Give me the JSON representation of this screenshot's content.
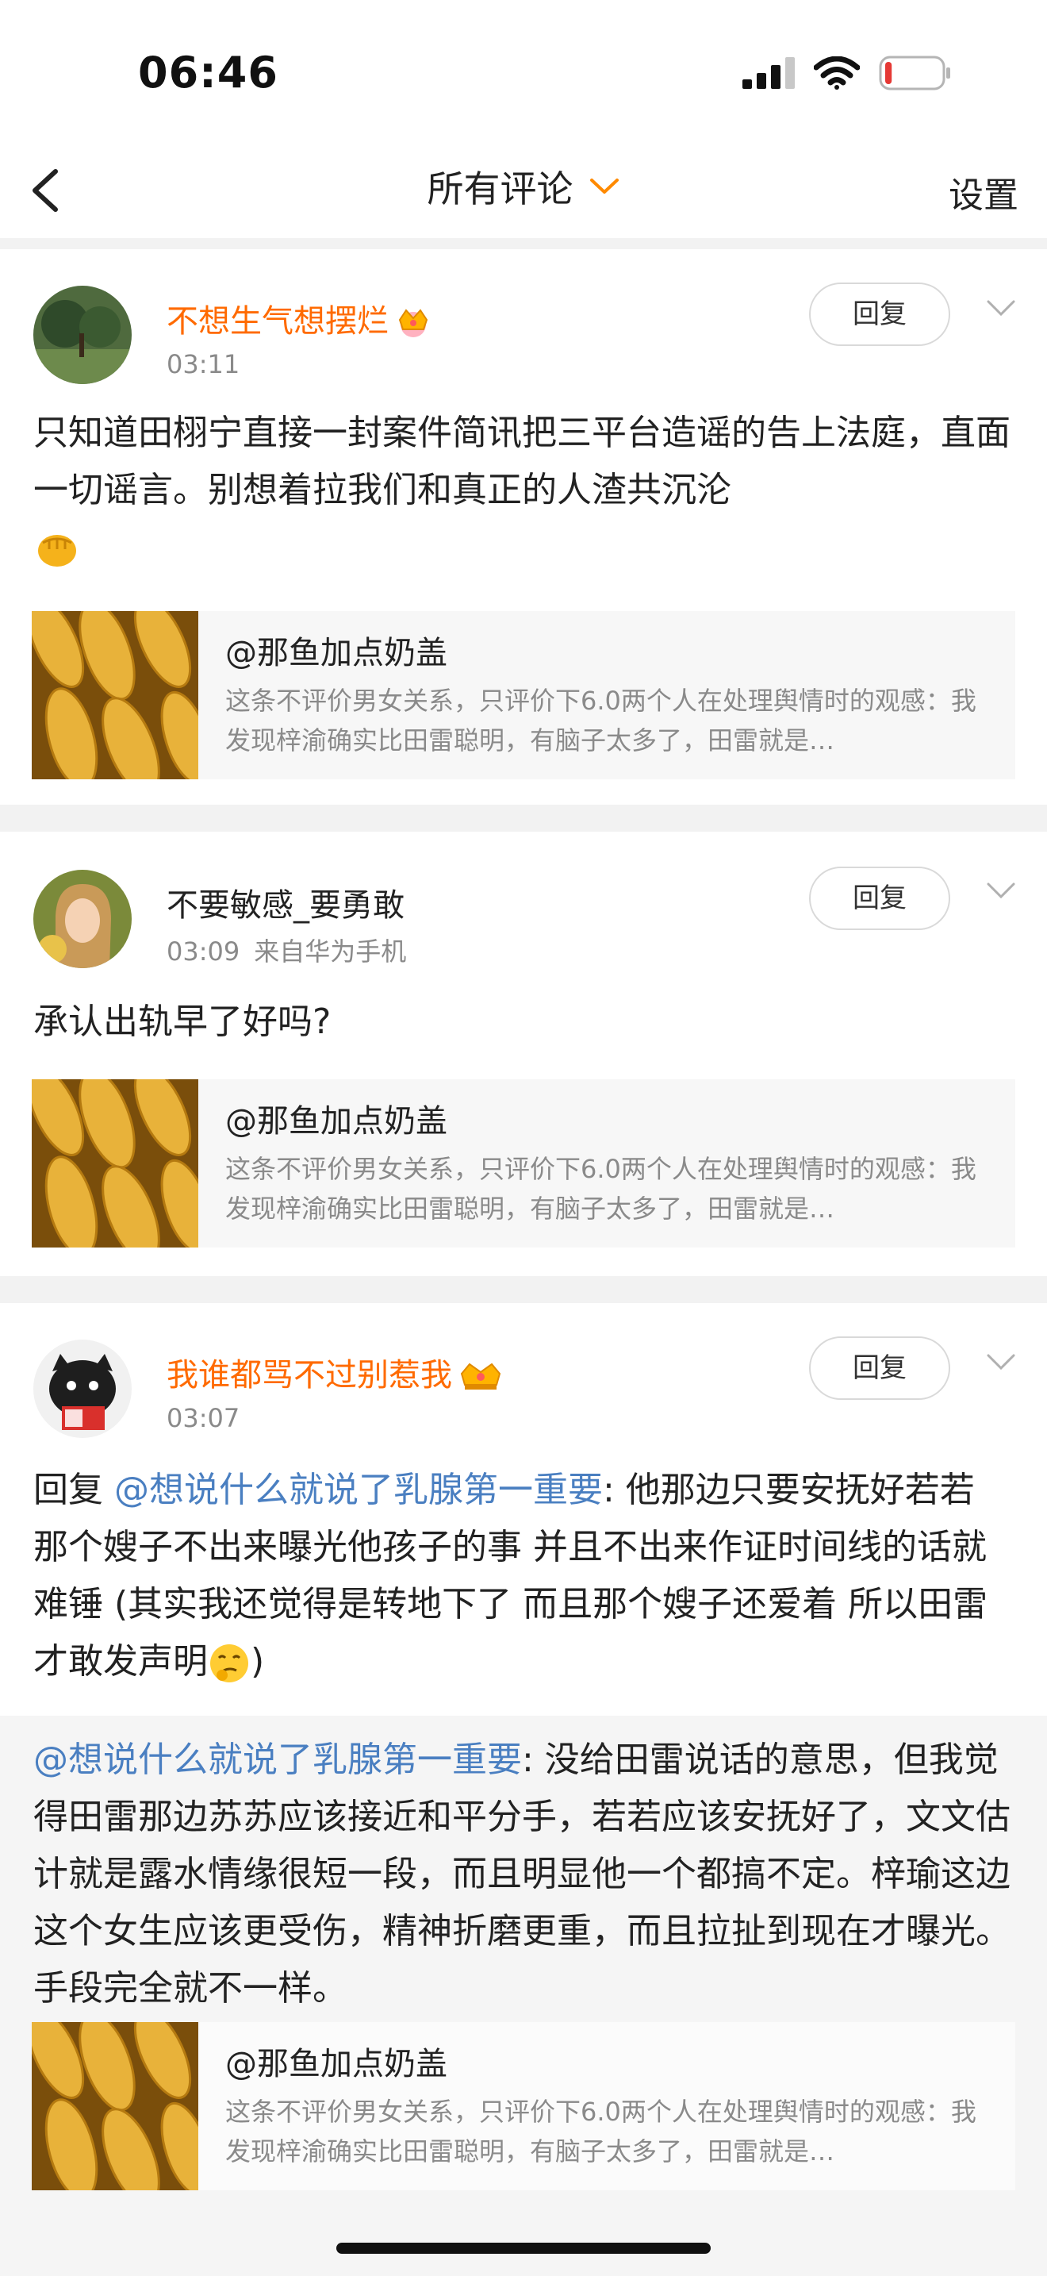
{
  "status_bar": {
    "time": "06:46",
    "battery_level": 0.12,
    "colors": {
      "battery_low": "#e53935"
    }
  },
  "nav": {
    "title": "所有评论",
    "settings": "设置"
  },
  "colors": {
    "vip_name": "#ff6a00",
    "mention": "#4a7fc1",
    "meta": "#8a8a8a",
    "gap": "#f2f2f2"
  },
  "comments": [
    {
      "username": "不想生气想摆烂",
      "vip": true,
      "time": "03:11",
      "source": "",
      "reply_button": "回复",
      "text": "只知道田栩宁直接一封案件简讯把三平台造谣的告上法庭，直面一切谣言。别想着拉我们和真正的人渣共沉沦",
      "emoji": "fist-emoji",
      "ref": {
        "title": "@那鱼加点奶盖",
        "desc": "这条不评价男女关系，只评价下6.0两个人在处理舆情时的观感：我发现梓渝确实比田雷聪明，有脑子太多了，田雷就是…"
      }
    },
    {
      "username": "不要敏感_要勇敢",
      "vip": false,
      "time": "03:09",
      "source": "来自华为手机",
      "reply_button": "回复",
      "text": "承认出轨早了好吗?",
      "ref": {
        "title": "@那鱼加点奶盖",
        "desc": "这条不评价男女关系，只评价下6.0两个人在处理舆情时的观感：我发现梓渝确实比田雷聪明，有脑子太多了，田雷就是…"
      }
    },
    {
      "username": "我谁都骂不过别惹我",
      "vip": true,
      "time": "03:07",
      "source": "",
      "reply_button": "回复",
      "reply_prefix": "回复 ",
      "reply_mention": "@想说什么就说了乳腺第一重要",
      "text": ": 他那边只要安抚好若若 那个嫂子不出来曝光他孩子的事 并且不出来作证时间线的话就难锤 (其实我还觉得是转地下了 而且那个嫂子还爱着 所以田雷才敢发声明",
      "text_end": ")",
      "emoji": "thinking-emoji",
      "quote": {
        "mention": "@想说什么就说了乳腺第一重要",
        "text": ": 没给田雷说话的意思，但我觉得田雷那边苏苏应该接近和平分手，若若应该安抚好了，文文估计就是露水情缘很短一段，而且明显他一个都搞不定。梓瑜这边这个女生应该更受伤，精神折磨更重，而且拉扯到现在才曝光。手段完全就不一样。"
      },
      "ref": {
        "title": "@那鱼加点奶盖",
        "desc": "这条不评价男女关系，只评价下6.0两个人在处理舆情时的观感：我发现梓渝确实比田雷聪明，有脑子太多了，田雷就是…"
      }
    }
  ]
}
